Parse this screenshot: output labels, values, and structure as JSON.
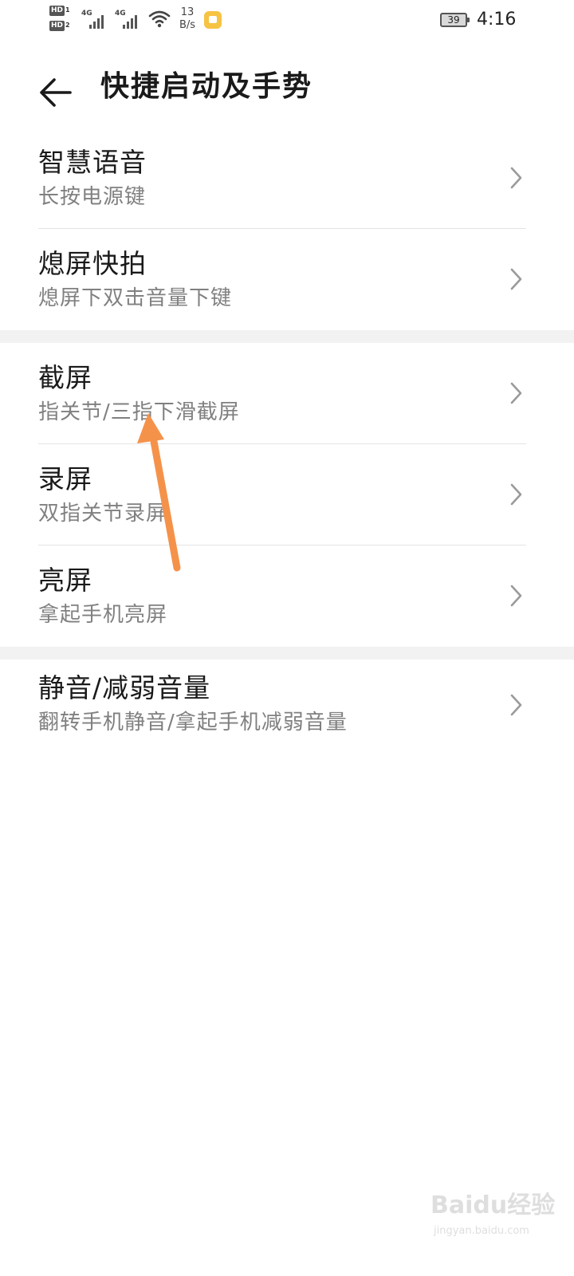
{
  "status_bar": {
    "sim1_hd": "HD",
    "sim1_slot": "1",
    "sim2_hd": "HD",
    "sim2_slot": "2",
    "sim1_network": "4G",
    "sim2_network": "4G",
    "net_speed_value": "13",
    "net_speed_unit": "B/s",
    "battery": "39",
    "time": "4:16",
    "icons": [
      "sim-signal-icon",
      "wifi-icon",
      "app-notification-icon",
      "battery-icon"
    ]
  },
  "header": {
    "back_icon": "back-arrow-icon",
    "title": "快捷启动及手势"
  },
  "groups": [
    {
      "items": [
        {
          "title": "智慧语音",
          "subtitle": "长按电源键"
        },
        {
          "title": "熄屏快拍",
          "subtitle": "熄屏下双击音量下键"
        }
      ]
    },
    {
      "items": [
        {
          "title": "截屏",
          "subtitle": "指关节/三指下滑截屏"
        },
        {
          "title": "录屏",
          "subtitle": "双指关节录屏"
        },
        {
          "title": "亮屏",
          "subtitle": "拿起手机亮屏"
        }
      ]
    },
    {
      "items": [
        {
          "title": "静音/减弱音量",
          "subtitle": "翻转手机静音/拿起手机减弱音量"
        }
      ]
    }
  ],
  "colors": {
    "annotation_arrow": "#f5924a",
    "background": "#ffffff",
    "section_separator": "#f2f2f2",
    "subtitle": "#808080"
  },
  "watermark": {
    "brand": "Baidu经验",
    "url": "jingyan.baidu.com"
  }
}
